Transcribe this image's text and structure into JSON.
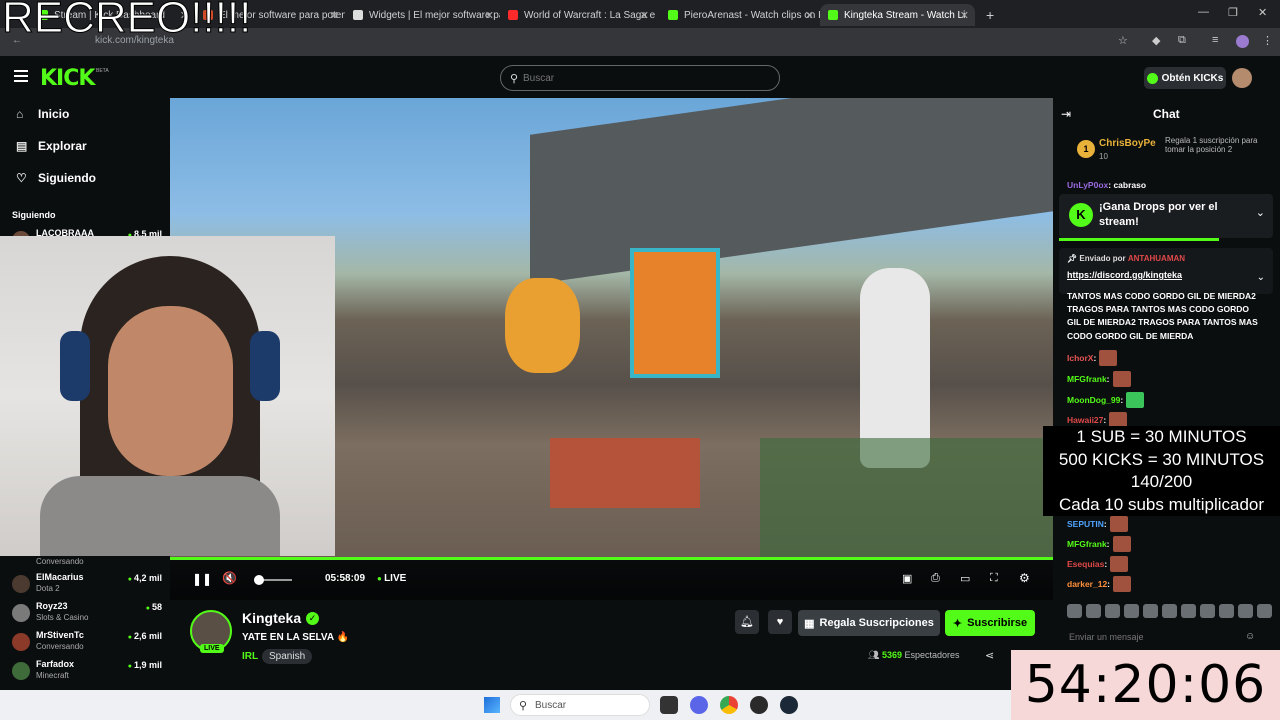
{
  "overlay": {
    "text": "RECREO!!!!!"
  },
  "browser": {
    "tabs": [
      {
        "title": "Stream | Kick Dashboard",
        "color": "#53fc18"
      },
      {
        "title": "El mejor software para potenciar",
        "color": "#d04a2a"
      },
      {
        "title": "Widgets | El mejor software para",
        "color": "#dddddd"
      },
      {
        "title": "World of Warcraft : La Saga en",
        "color": "#ff2a2a"
      },
      {
        "title": "PieroArenast - Watch clips on K",
        "color": "#53fc18"
      },
      {
        "title": "Kingteka Stream - Watch Li",
        "color": "#53fc18"
      }
    ],
    "url": "kick.com/kingteka"
  },
  "header": {
    "logo": "KICK",
    "beta": "BETA",
    "search_placeholder": "Buscar",
    "get_kicks": "Obtén KICKs"
  },
  "sidebar": {
    "nav": [
      {
        "label": "Inicio",
        "icon": "home-icon",
        "glyph": "⌂"
      },
      {
        "label": "Explorar",
        "icon": "browse-icon",
        "glyph": "▤"
      },
      {
        "label": "Siguiendo",
        "icon": "heart-icon",
        "glyph": "♡"
      }
    ],
    "following_label": "Siguiendo",
    "following": [
      {
        "name": "LACOBRAAA",
        "category": "",
        "viewers": "8,5 mil"
      },
      {
        "name": "ElMacarius",
        "category": "Dota 2",
        "viewers": "4,2 mil"
      },
      {
        "name": "Royz23",
        "category": "Slots & Casino",
        "viewers": "58"
      },
      {
        "name": "MrStivenTc",
        "category": "Conversando",
        "viewers": "2,6 mil"
      },
      {
        "name": "Farfadox",
        "category": "Minecraft",
        "viewers": "1,9 mil"
      }
    ],
    "partial_category": "Conversando"
  },
  "player": {
    "time": "05:58:09",
    "live": "LIVE"
  },
  "stream": {
    "channel": "Kingteka",
    "title": "YATE EN LA SELVA 🔥",
    "category": "IRL",
    "language": "Spanish",
    "live_badge": "LIVE",
    "gift_button": "Regala Suscripciones",
    "subscribe_button": "Suscribirse",
    "viewer_count": "5369",
    "viewer_label": "Espectadores"
  },
  "chat": {
    "title": "Chat",
    "top_gifter": {
      "rank": "1",
      "name": "ChrisBoyPe",
      "count": "10",
      "desc": "Regala 1 suscripción para tomar la posición 2"
    },
    "partial_user": "UnLyP0ox",
    "partial_text": ": cabraso",
    "drops": "¡Gana Drops por ver el stream!",
    "pinned": {
      "sent_by": "Enviado por",
      "sender": "ANTAHUAMAN",
      "link": "https://discord.gg/kingteka"
    },
    "long_message": "TANTOS MAS CODO GORDO GIL DE MIERDA2 TRAGOS PARA TANTOS MAS CODO GORDO GIL DE MIERDA2 TRAGOS PARA TANTOS MAS CODO GORDO GIL DE MIERDA",
    "messages": [
      {
        "user": "IchorX",
        "color": "#e85454"
      },
      {
        "user": "MFGfrank",
        "color": "#53fc18"
      },
      {
        "user": "MoonDog_99",
        "color": "#53fc18"
      },
      {
        "user": "Hawaii27",
        "color": "#e04848"
      }
    ],
    "messages_bottom": [
      {
        "user": "SEPUTIN",
        "color": "#4fa3ff"
      },
      {
        "user": "MFGfrank",
        "color": "#53fc18"
      },
      {
        "user": "Esequias",
        "color": "#e04848"
      },
      {
        "user": "darker_12",
        "color": "#ff8f3a"
      }
    ],
    "input_placeholder": "Enviar un mensaje"
  },
  "goal": {
    "lines": [
      "1 SUB      = 30 MINUTOS",
      "500 KICKS = 30 MINUTOS",
      "140/200",
      "Cada 10 subs multiplicador"
    ]
  },
  "countdown": "54:20:06",
  "taskbar": {
    "search": "Buscar"
  }
}
